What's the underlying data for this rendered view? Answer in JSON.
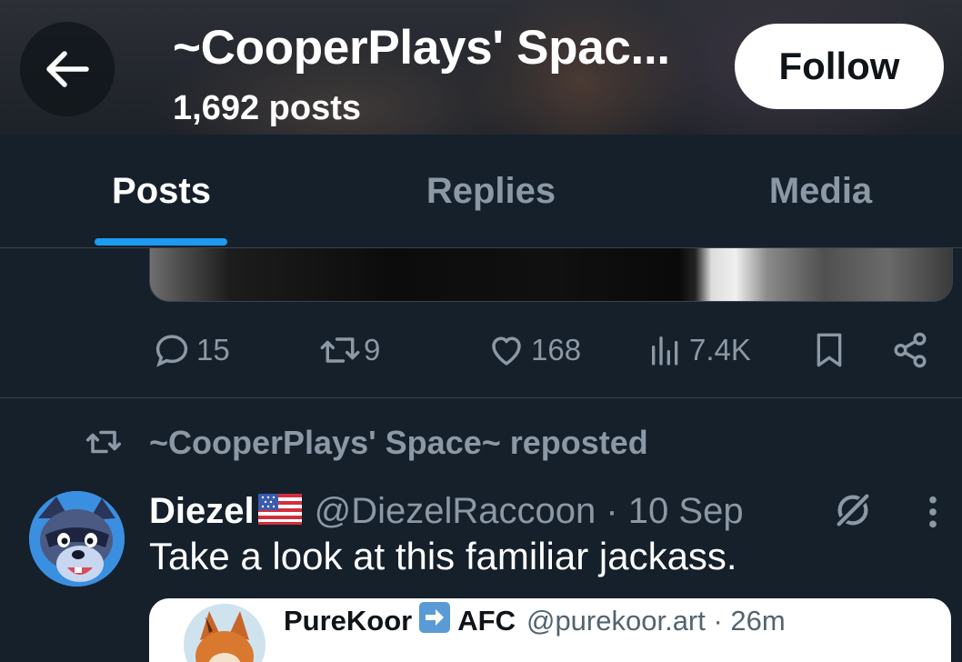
{
  "header": {
    "title": "~CooperPlays' Spac...",
    "post_count": "1,692 posts",
    "follow_label": "Follow",
    "back_icon": "arrow-left-icon"
  },
  "tabs": [
    {
      "label": "Posts",
      "active": true
    },
    {
      "label": "Replies",
      "active": false
    },
    {
      "label": "Media",
      "active": false
    }
  ],
  "colors": {
    "background": "#15202b",
    "accent": "#1d9bf0",
    "muted_text": "#8b98a5",
    "divider": "#38444d"
  },
  "actions": {
    "replies": "15",
    "reposts": "9",
    "likes": "168",
    "views": "7.4K",
    "icons": [
      "reply-icon",
      "repost-icon",
      "like-icon",
      "views-icon",
      "bookmark-icon",
      "share-icon"
    ]
  },
  "repost": {
    "text": "~CooperPlays' Space~ reposted"
  },
  "tweet": {
    "name": "Diezel",
    "handle_time": "@DiezelRaccoon · 10 Sep",
    "text": "Take a look at this familiar jackass."
  },
  "quote": {
    "name": "PureKoor",
    "afc": "AFC",
    "handle_time": "@purekoor.art · 26m"
  }
}
